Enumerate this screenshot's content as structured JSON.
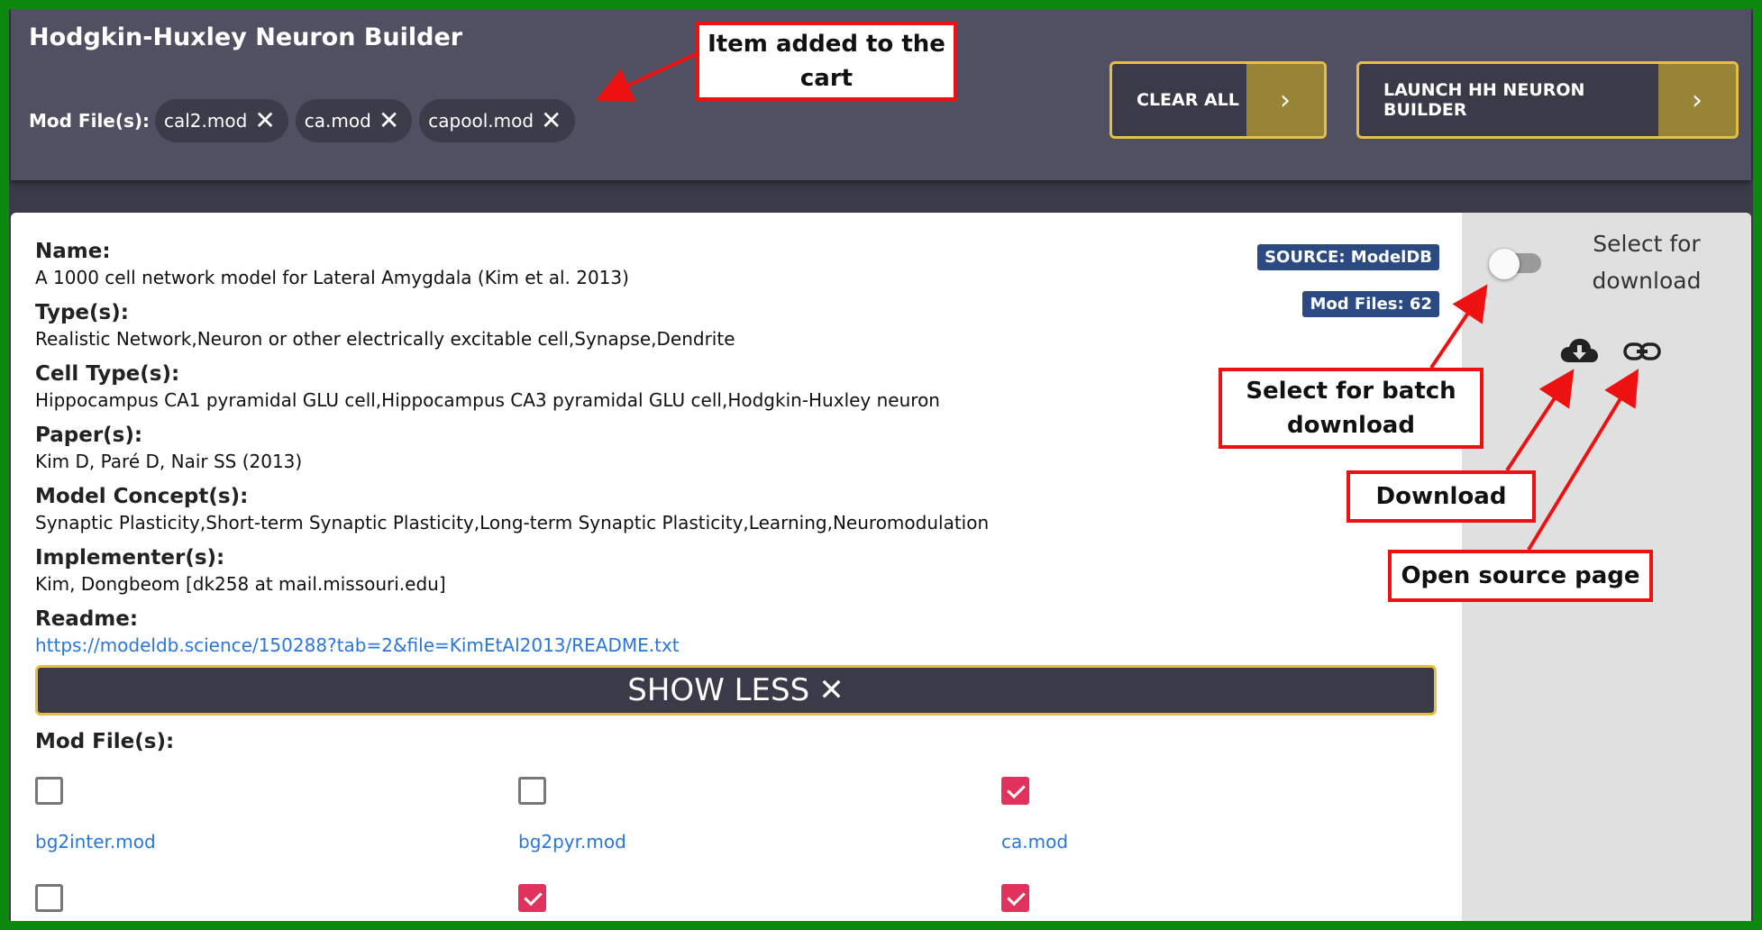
{
  "header": {
    "title": "Hodgkin-Huxley Neuron Builder",
    "mod_files_label": "Mod File(s):",
    "cart": [
      {
        "label": "cal2.mod",
        "remove": "✕"
      },
      {
        "label": "ca.mod",
        "remove": "✕"
      },
      {
        "label": "capool.mod",
        "remove": "✕"
      }
    ],
    "clear_all": "CLEAR ALL",
    "launch": "LAUNCH HH NEURON BUILDER",
    "arrow": "›"
  },
  "model": {
    "name_label": "Name:",
    "name": "A 1000 cell network model for Lateral Amygdala (Kim et al. 2013)",
    "types_label": "Type(s):",
    "types": "Realistic Network,Neuron or other electrically excitable cell,Synapse,Dendrite",
    "cell_types_label": "Cell Type(s):",
    "cell_types": "Hippocampus CA1 pyramidal GLU cell,Hippocampus CA3 pyramidal GLU cell,Hodgkin-Huxley neuron",
    "papers_label": "Paper(s):",
    "papers": "Kim D, Paré D, Nair SS (2013)",
    "concepts_label": "Model Concept(s):",
    "concepts": "Synaptic Plasticity,Short-term Synaptic Plasticity,Long-term Synaptic Plasticity,Learning,Neuromodulation",
    "implementers_label": "Implementer(s):",
    "implementers": "Kim, Dongbeom [dk258 at mail.missouri.edu]",
    "readme_label": "Readme:",
    "readme": "https://modeldb.science/150288?tab=2&file=KimEtAl2013/README.txt",
    "source_badge": "SOURCE: ModelDB",
    "modfiles_badge": "Mod Files: 62",
    "show_less": "SHOW LESS",
    "show_less_icon": "✕",
    "mod_files_label": "Mod File(s):",
    "mod_files": [
      {
        "name": "bg2inter.mod",
        "checked": false
      },
      {
        "name": "bg2pyr.mod",
        "checked": false
      },
      {
        "name": "ca.mod",
        "checked": true
      }
    ],
    "next_row_checked": [
      false,
      true,
      true
    ]
  },
  "side": {
    "select_label": "Select for download",
    "toggle_on": false,
    "icons": [
      "cloud-download-icon",
      "link-icon"
    ]
  },
  "annotations": {
    "cart": "Item added to the cart",
    "batch": "Select for batch download",
    "download": "Download",
    "source": "Open source page"
  },
  "colors": {
    "accent_gold": "#e5bf45",
    "checkbox_checked": "#e0325c",
    "badge_bg": "#2c4a82",
    "annotation_red": "#ee1111",
    "frame_green": "#0c8a10"
  }
}
